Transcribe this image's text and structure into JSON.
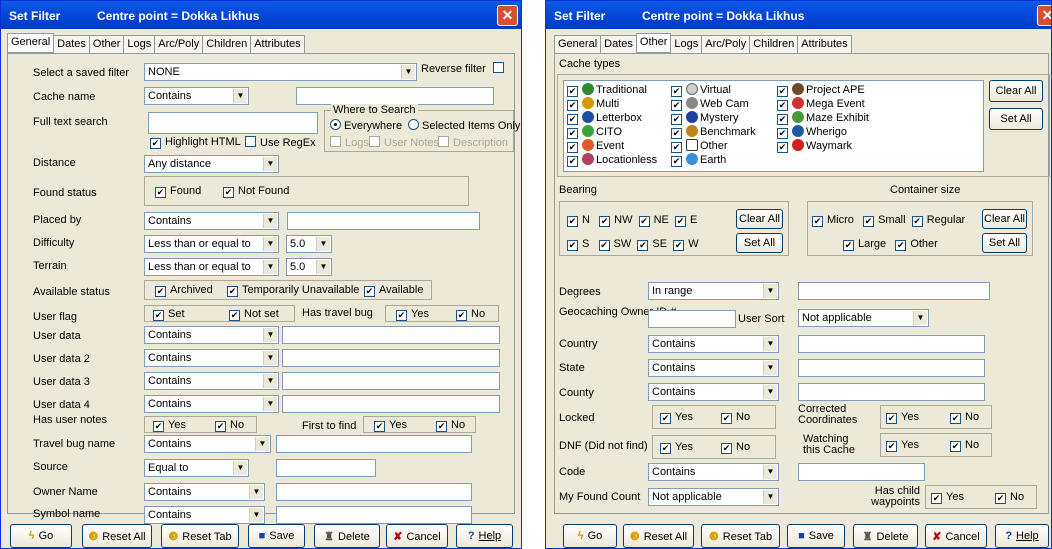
{
  "w1": {
    "title": "Set Filter",
    "subtitle": "Centre point = Dokka Likhus",
    "tabs": [
      "General",
      "Dates",
      "Other",
      "Logs",
      "Arc/Poly",
      "Children",
      "Attributes"
    ],
    "saved_filter_label": "Select a saved filter",
    "saved_filter_value": "NONE",
    "reverse_filter_label": "Reverse filter",
    "cache_name_label": "Cache name",
    "cache_name_op": "Contains",
    "full_text_label": "Full text search",
    "highlight_html": "Highlight HTML",
    "use_regex": "Use RegEx",
    "where_title": "Where to Search",
    "everywhere": "Everywhere",
    "selected_items": "Selected Items Only",
    "logs": "Logs",
    "user_notes": "User Notes",
    "description": "Description",
    "distance_label": "Distance",
    "distance_value": "Any distance",
    "found_status_label": "Found status",
    "found": "Found",
    "not_found": "Not Found",
    "placed_by_label": "Placed by",
    "placed_by_op": "Contains",
    "difficulty_label": "Difficulty",
    "difficulty_op": "Less than or equal to",
    "difficulty_val": "5.0",
    "terrain_label": "Terrain",
    "terrain_op": "Less than or equal to",
    "terrain_val": "5.0",
    "available_label": "Available status",
    "archived": "Archived",
    "temp_unavailable": "Temporarily Unavailable",
    "available": "Available",
    "user_flag_label": "User flag",
    "set": "Set",
    "not_set": "Not set",
    "has_travel_bug_label": "Has travel bug",
    "yes": "Yes",
    "no": "No",
    "user_data_label": "User data",
    "user_data2_label": "User data 2",
    "user_data3_label": "User data 3",
    "user_data4_label": "User data 4",
    "contains": "Contains",
    "has_user_notes_label": "Has user notes",
    "first_to_find_label": "First to find",
    "travel_bug_name_label": "Travel bug name",
    "source_label": "Source",
    "source_op": "Equal to",
    "owner_name_label": "Owner Name",
    "symbol_name_label": "Symbol name"
  },
  "w2": {
    "title": "Set Filter",
    "subtitle": "Centre point = Dokka Likhus",
    "tabs": [
      "General",
      "Dates",
      "Other",
      "Logs",
      "Arc/Poly",
      "Children",
      "Attributes"
    ],
    "cache_types_label": "Cache types",
    "cache_types": [
      [
        "Traditional",
        "Multi",
        "Letterbox",
        "CITO",
        "Event",
        "Locationless"
      ],
      [
        "Virtual",
        "Web Cam",
        "Mystery",
        "Benchmark",
        "Other",
        "Earth"
      ],
      [
        "Project APE",
        "Mega Event",
        "Maze Exhibit",
        "Wherigo",
        "Waymark"
      ]
    ],
    "clear_all": "Clear All",
    "set_all": "Set All",
    "bearing_label": "Bearing",
    "bearing_row1": [
      "N",
      "NW",
      "NE",
      "E"
    ],
    "bearing_row2": [
      "S",
      "SW",
      "SE",
      "W"
    ],
    "container_label": "Container size",
    "container_row1": [
      "Micro",
      "Small",
      "Regular"
    ],
    "container_row2": [
      "Large",
      "Other"
    ],
    "degrees_label": "Degrees",
    "degrees_op": "In range",
    "gc_owner_label": "Geocaching Owner ID #",
    "user_sort_label": "User Sort",
    "user_sort_val": "Not applicable",
    "country_label": "Country",
    "state_label": "State",
    "county_label": "County",
    "contains": "Contains",
    "locked_label": "Locked",
    "corrected_label": "Corrected Coordinates",
    "dnf_label": "DNF (Did not find)",
    "watching_label": "Watching this Cache",
    "code_label": "Code",
    "my_found_label": "My Found Count",
    "my_found_val": "Not applicable",
    "has_child_label": "Has child waypoints",
    "yes": "Yes",
    "no": "No"
  },
  "buttons": [
    "Go",
    "Reset All",
    "Reset Tab",
    "Save",
    "Delete",
    "Cancel",
    "Help"
  ]
}
